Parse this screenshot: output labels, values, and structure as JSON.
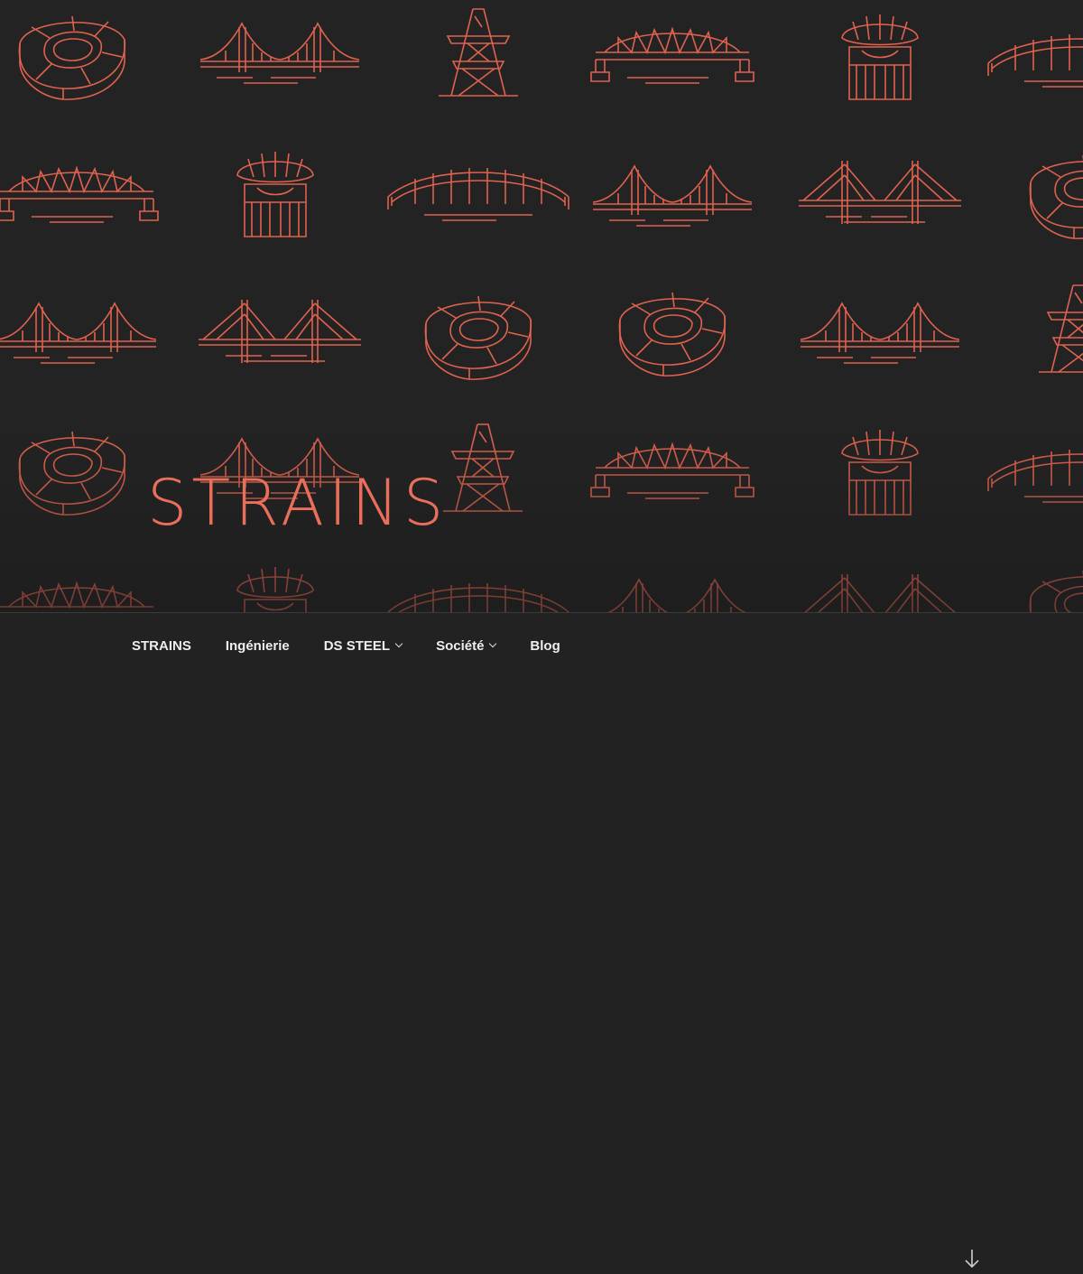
{
  "site": {
    "title": "STRAINS"
  },
  "colors": {
    "accent": "#e96f5b",
    "background": "#232323",
    "nav_background": "#222222",
    "nav_text": "#eeeeee"
  },
  "hero": {
    "pattern_icons": [
      "stadium-icon",
      "suspension-bridge-icon",
      "pylon-icon",
      "truss-bridge-icon",
      "arch-bridge-icon",
      "cable-stayed-bridge-icon"
    ]
  },
  "nav": {
    "items": [
      {
        "label": "STRAINS",
        "has_dropdown": false
      },
      {
        "label": "Ingénierie",
        "has_dropdown": false
      },
      {
        "label": "DS STEEL",
        "has_dropdown": true
      },
      {
        "label": "Société",
        "has_dropdown": true
      },
      {
        "label": "Blog",
        "has_dropdown": false
      }
    ],
    "scroll_icon": "arrow-down-icon"
  }
}
